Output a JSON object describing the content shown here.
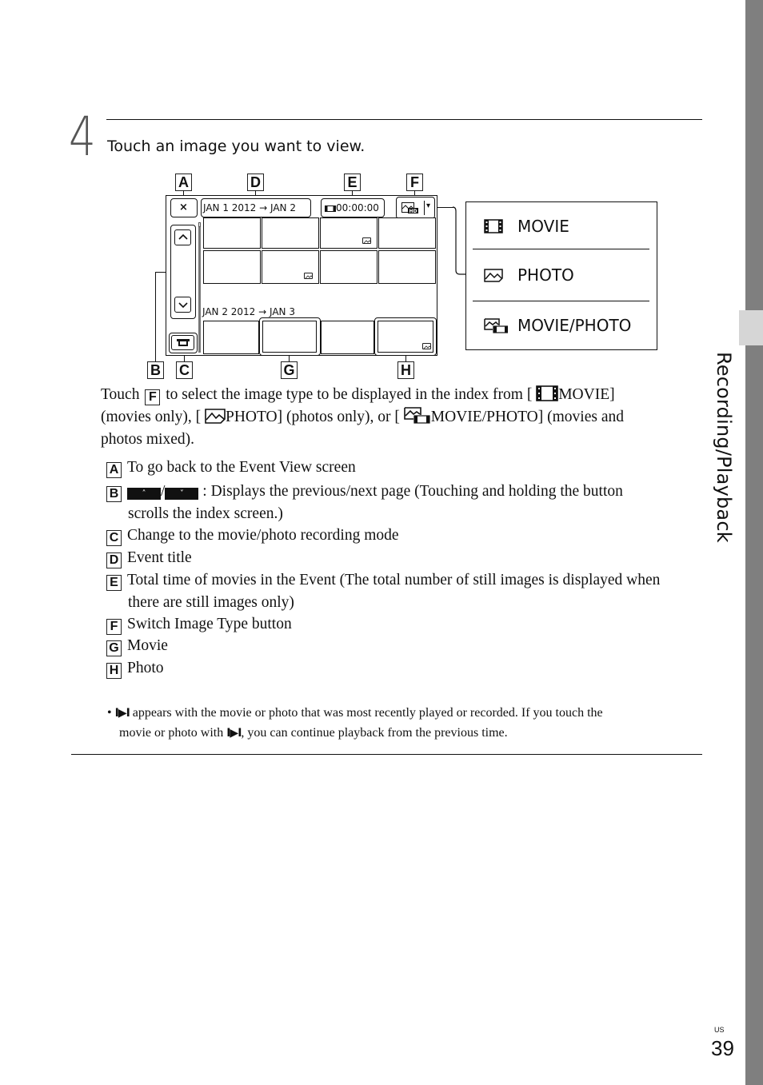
{
  "sidebar": {
    "section_label": "Recording/Playback",
    "colors": {
      "band": "#7f7f7f",
      "tab": "#d6d6d6"
    }
  },
  "page": {
    "lang": "US",
    "number": "39"
  },
  "step": {
    "number": "4",
    "title": "Touch an image you want to view."
  },
  "figure": {
    "callouts": [
      "A",
      "B",
      "C",
      "D",
      "E",
      "F",
      "G",
      "H"
    ],
    "screen": {
      "close_icon": "close-icon",
      "event_title_1": "JAN 1 2012  →  JAN 2",
      "total_time": "00:00:00",
      "event_title_2": "JAN 2 2012  →  JAN 3",
      "switch_type_icon": "movie-photo-hd-icon",
      "dropdown_icon": "▾",
      "scroll_up_icon": "⌃",
      "scroll_down_icon": "⌄",
      "mode_icon": "camera-icon"
    },
    "menu": {
      "items": [
        {
          "label": "MOVIE",
          "icon": "film-icon"
        },
        {
          "label": "PHOTO",
          "icon": "photo-icon"
        },
        {
          "label": "MOVIE/PHOTO",
          "icon": "movie-photo-icon"
        }
      ]
    }
  },
  "intro": {
    "l1_a": "Touch",
    "l1_box": "F",
    "l1_b": "to select the image type to be displayed in the index from [",
    "l1_c": "MOVIE]",
    "l2_a": "(movies only), [",
    "l2_b": "PHOTO] (photos only), or [",
    "l2_c": "MOVIE/PHOTO] (movies and",
    "l3": "photos mixed)."
  },
  "legend": [
    {
      "key": "A",
      "text": "To go back to the Event View screen"
    },
    {
      "key": "B",
      "text": ": Displays the previous/next page (Touching and holding the button",
      "cont": "scrolls the index screen.)",
      "btn_up": "˄",
      "btn_down": "˅",
      "sep": "/"
    },
    {
      "key": "C",
      "text": "Change to the movie/photo recording mode"
    },
    {
      "key": "D",
      "text": "Event title"
    },
    {
      "key": "E",
      "text": "Total time of movies in the Event (The total number of still images is displayed when",
      "cont": "there are still images only)"
    },
    {
      "key": "F",
      "text": "Switch Image Type button"
    },
    {
      "key": "G",
      "text": "Movie"
    },
    {
      "key": "H",
      "text": "Photo"
    }
  ],
  "note": {
    "bullet": "•",
    "resume_icon": "I▶I",
    "l1": "appears with the movie or photo that was most recently played or recorded. If you touch the",
    "l2_a": "movie or photo with",
    "l2_b": ", you can continue playback from the previous time."
  }
}
